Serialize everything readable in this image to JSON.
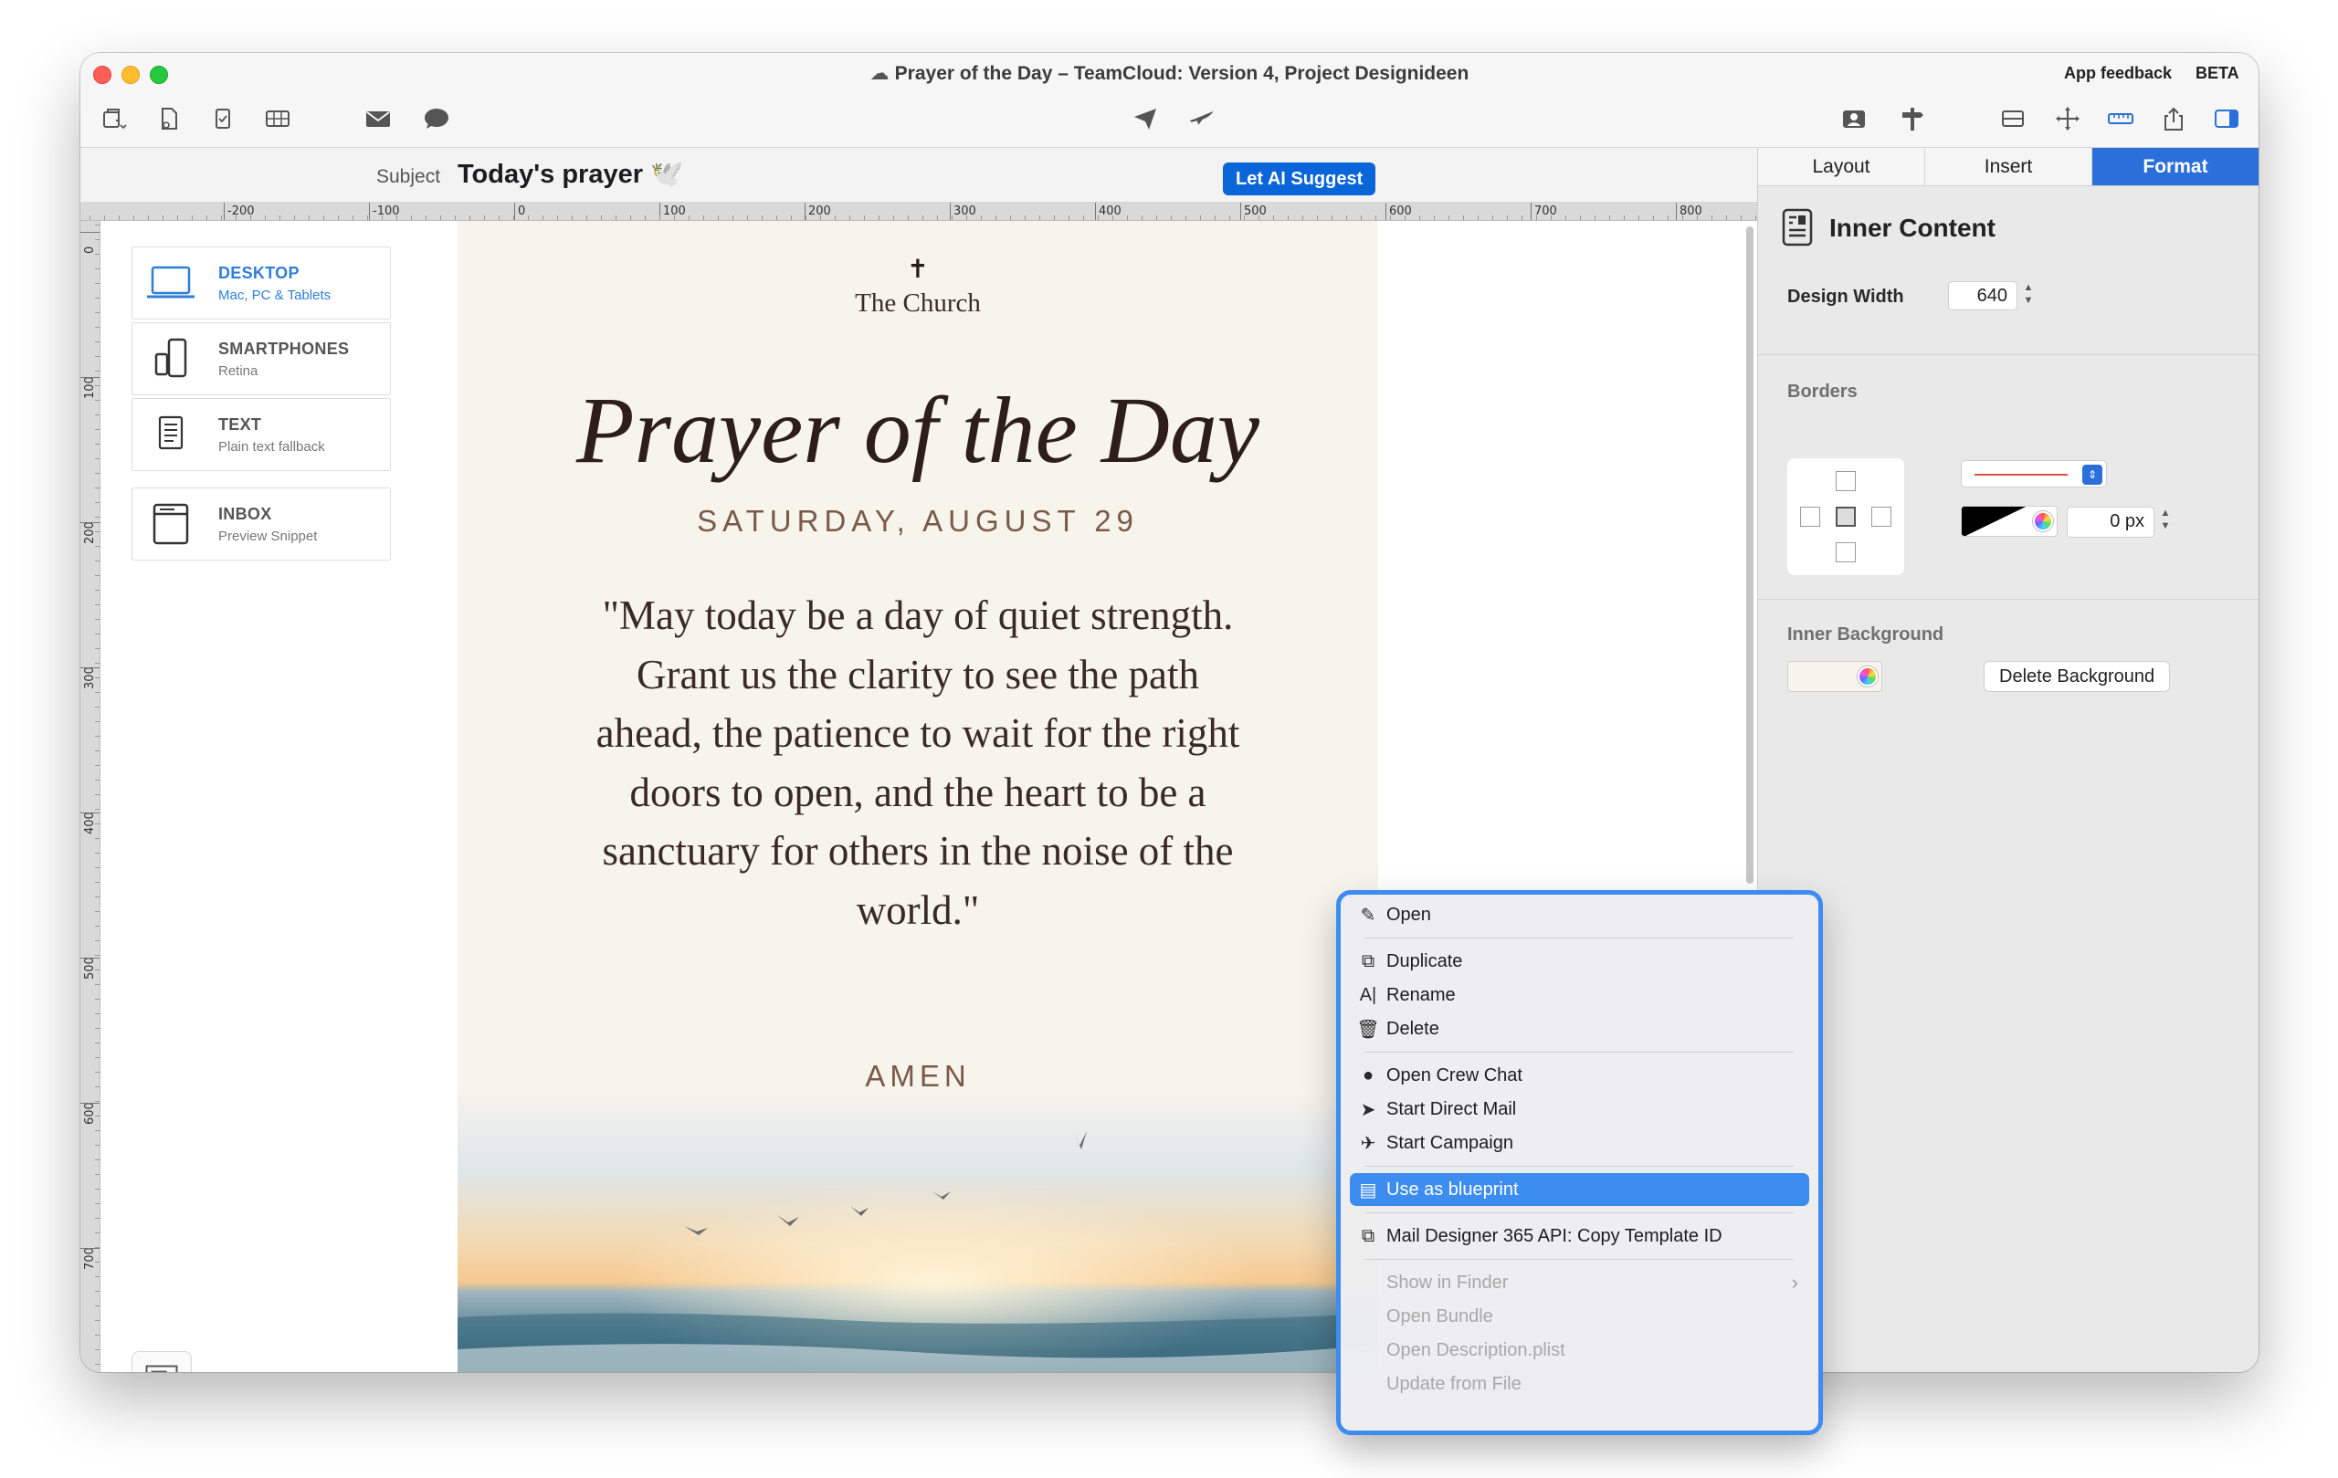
{
  "window": {
    "title": "Prayer of the Day – TeamCloud: Version 4, Project  Designideen",
    "cloud_icon": "cloud-icon",
    "app_feedback": "App feedback",
    "beta": "BETA"
  },
  "toolbar": {
    "left_icons": [
      "layout-icon",
      "document-icon",
      "checklist-icon",
      "grid-icon",
      "mail-icon",
      "chat-bubble-icon"
    ],
    "center_icons": [
      "paper-plane-icon",
      "airplane-icon"
    ],
    "right_icons": [
      "contact-card-icon",
      "signpost-icon",
      "rows-icon",
      "move-icon",
      "ruler-icon",
      "share-icon",
      "sidebar-icon"
    ]
  },
  "subject": {
    "label": "Subject",
    "value": "Today's prayer 🕊️",
    "ai_button": "Let AI Suggest"
  },
  "ruler": {
    "horizontal": [
      "-200",
      "-100",
      "0",
      "100",
      "200",
      "300",
      "400",
      "500",
      "600",
      "700",
      "800"
    ],
    "vertical": [
      "0",
      "100",
      "200",
      "300",
      "400",
      "500",
      "600",
      "700"
    ]
  },
  "views": [
    {
      "name": "DESKTOP",
      "sub": "Mac, PC & Tablets",
      "icon": "laptop-icon",
      "active": true
    },
    {
      "name": "SMARTPHONES",
      "sub": "Retina",
      "icon": "smartphone-icon",
      "active": false
    },
    {
      "name": "TEXT",
      "sub": "Plain text fallback",
      "icon": "text-document-icon",
      "active": false
    },
    {
      "name": "INBOX",
      "sub": "Preview Snippet",
      "icon": "inbox-icon",
      "active": false
    }
  ],
  "email": {
    "cross": "✝",
    "church": "The Church",
    "headline": "Prayer of the Day",
    "date": "SATURDAY, AUGUST 29",
    "prayer": "\"May today be a day of quiet strength. Grant us the clarity to see the path ahead, the patience to wait for the right doors to open, and the heart to be a sanctuary for others in the noise of the world.\"",
    "amen": "AMEN"
  },
  "panel": {
    "tabs": [
      {
        "label": "Layout",
        "active": false
      },
      {
        "label": "Insert",
        "active": false
      },
      {
        "label": "Format",
        "active": true
      }
    ],
    "title": "Inner Content",
    "design_width_label": "Design Width",
    "design_width_value": "640",
    "borders_label": "Borders",
    "border_px": "0 px",
    "inner_bg_label": "Inner Background",
    "delete_bg_button": "Delete Background"
  },
  "context_menu": {
    "groups": [
      [
        {
          "label": "Open",
          "icon": "pencil-icon"
        }
      ],
      [
        {
          "label": "Duplicate",
          "icon": "duplicate-icon"
        },
        {
          "label": "Rename",
          "icon": "rename-icon"
        },
        {
          "label": "Delete",
          "icon": "trash-icon"
        }
      ],
      [
        {
          "label": "Open Crew Chat",
          "icon": "chat-bubble-icon"
        },
        {
          "label": "Start Direct Mail",
          "icon": "paper-plane-icon"
        },
        {
          "label": "Start Campaign",
          "icon": "airplane-icon"
        }
      ],
      [
        {
          "label": "Use as blueprint",
          "icon": "blueprint-icon",
          "highlighted": true
        }
      ],
      [
        {
          "label": "Mail Designer 365 API: Copy Template ID",
          "icon": "copy-icon"
        }
      ],
      [
        {
          "label": "Show in Finder",
          "disabled": true,
          "submenu": true
        },
        {
          "label": "Open Bundle",
          "disabled": true
        },
        {
          "label": "Open Description.plist",
          "disabled": true
        },
        {
          "label": "Update from File",
          "disabled": true
        }
      ]
    ]
  },
  "colors": {
    "accent": "#2b6fdb",
    "menu_highlight": "#3d8cf0",
    "email_bg": "#f7f4ec",
    "heading": "#2d1e1c",
    "date_color": "#7a5a48"
  }
}
